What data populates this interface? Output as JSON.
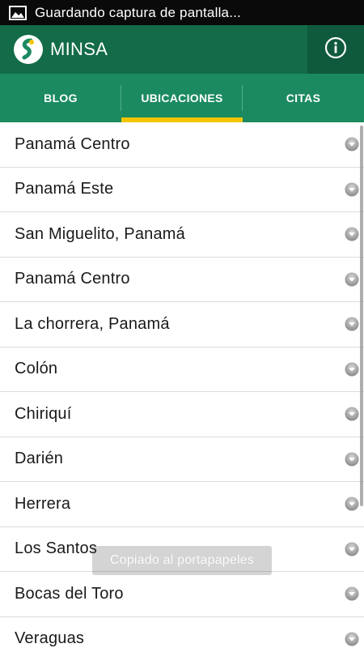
{
  "status_bar": {
    "notification_icon": "image-icon",
    "text": "Guardando captura de pantalla..."
  },
  "action_bar": {
    "title": "MINSA",
    "logo_icon": "minsa-logo-icon",
    "info_icon": "info-icon"
  },
  "tabs": [
    {
      "label": "BLOG",
      "selected": false
    },
    {
      "label": "UBICACIONES",
      "selected": true
    },
    {
      "label": "CITAS",
      "selected": false
    }
  ],
  "colors": {
    "action_bar": "#136b48",
    "tab_bar": "#1b8a60",
    "tab_indicator": "#f2c500"
  },
  "locations": [
    {
      "label": "Panamá Centro"
    },
    {
      "label": "Panamá Este"
    },
    {
      "label": "San Miguelito, Panamá"
    },
    {
      "label": "Panamá Centro"
    },
    {
      "label": "La chorrera, Panamá"
    },
    {
      "label": "Colón"
    },
    {
      "label": "Chiriquí"
    },
    {
      "label": "Darién"
    },
    {
      "label": "Herrera"
    },
    {
      "label": "Los Santos"
    },
    {
      "label": "Bocas del Toro"
    },
    {
      "label": "Veraguas"
    }
  ],
  "toast": {
    "text": "Copiado al portapapeles"
  }
}
